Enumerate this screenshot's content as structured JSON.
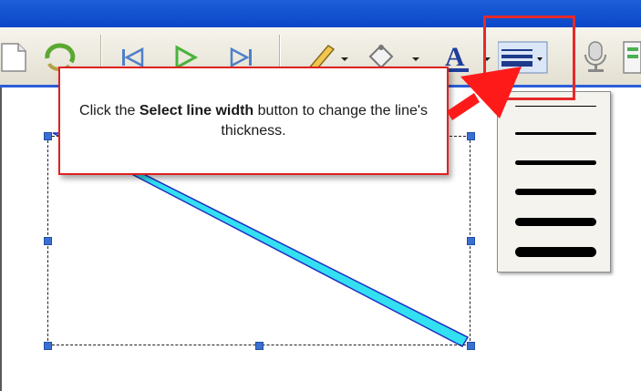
{
  "callout": {
    "text_before": "Click the ",
    "text_bold": "Select line width",
    "text_after": " button to change the line's thickness."
  },
  "toolbar": {
    "icons": [
      "new-document-icon",
      "refresh-icon",
      "skip-back-icon",
      "play-icon",
      "skip-forward-icon",
      "pencil-icon",
      "fill-bucket-icon",
      "font-color-icon",
      "line-width-icon",
      "microphone-icon",
      "slide-icon"
    ],
    "font_color_glyph": "A",
    "highlighted_tool": "Select line width"
  },
  "line_width_menu": {
    "option_count": 6,
    "options": [
      "thinnest",
      "thin",
      "medium",
      "thick",
      "thicker",
      "thickest"
    ]
  },
  "colors": {
    "highlight": "#e42a2a",
    "arrow": "#ff1a1a",
    "line_fill": "#33e0f2",
    "line_stroke": "#1f2fc0",
    "handle": "#3b6fd0",
    "title_bar": "#1e5fd8"
  }
}
